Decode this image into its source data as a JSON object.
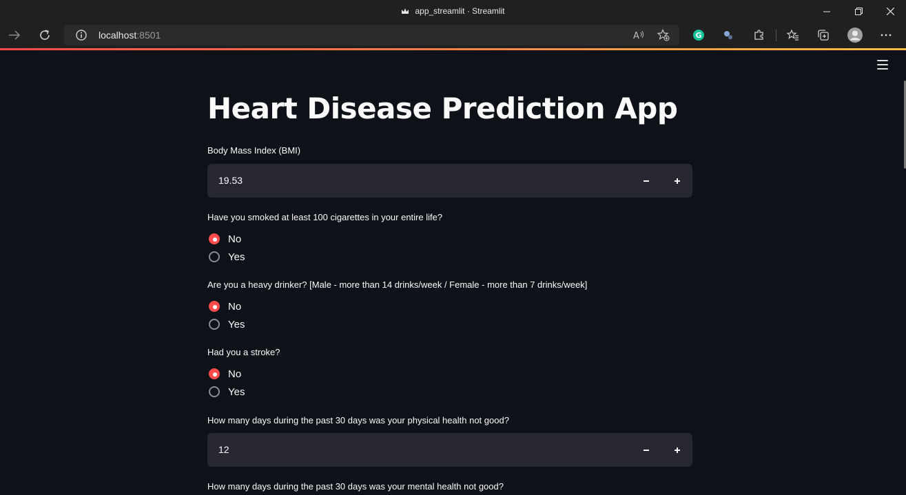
{
  "browser": {
    "window_title": "app_streamlit · Streamlit",
    "url_host": "localhost",
    "url_port": ":8501"
  },
  "app": {
    "title": "Heart Disease Prediction App",
    "bmi": {
      "label": "Body Mass Index (BMI)",
      "value": "19.53"
    },
    "smoking": {
      "label": "Have you smoked at least 100 cigarettes in your entire life?",
      "options": [
        "No",
        "Yes"
      ],
      "selected": "No"
    },
    "drinking": {
      "label": "Are you a heavy drinker? [Male - more than 14 drinks/week / Female - more than 7 drinks/week]",
      "options": [
        "No",
        "Yes"
      ],
      "selected": "No"
    },
    "stroke": {
      "label": "Had you a stroke?",
      "options": [
        "No",
        "Yes"
      ],
      "selected": "No"
    },
    "physical_health": {
      "label": "How many days during the past 30 days was your physical health not good?",
      "value": "12"
    },
    "mental_health": {
      "label": "How many days during the past 30 days was your mental health not good?"
    }
  },
  "colors": {
    "accent": "#ff4b4b",
    "background": "#0e1117",
    "input_bg": "#262730"
  }
}
